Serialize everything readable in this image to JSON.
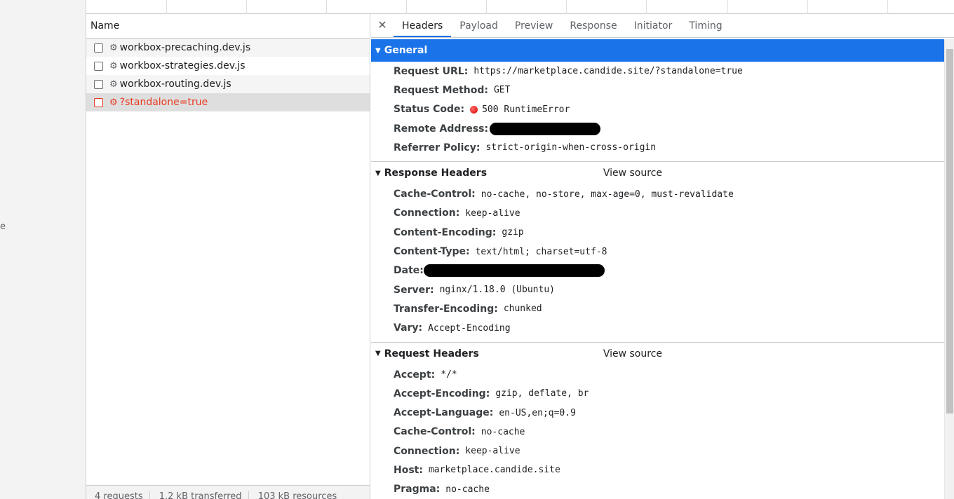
{
  "left_panel": {
    "stub_text": "e"
  },
  "request_list": {
    "column_name": "Name",
    "rows": [
      {
        "name": "workbox-precaching.dev.js"
      },
      {
        "name": "workbox-strategies.dev.js"
      },
      {
        "name": "workbox-routing.dev.js"
      },
      {
        "name": "?standalone=true"
      }
    ],
    "status_bar": {
      "requests": "4 requests",
      "transferred": "1.2 kB transferred",
      "resources": "103 kB resources"
    }
  },
  "tabs": [
    "Headers",
    "Payload",
    "Preview",
    "Response",
    "Initiator",
    "Timing"
  ],
  "general": {
    "title": "General",
    "request_url_key": "Request URL:",
    "request_url": "https://marketplace.candide.site/?standalone=true",
    "request_method_key": "Request Method:",
    "request_method": "GET",
    "status_code_key": "Status Code:",
    "status_code": "500 RuntimeError",
    "remote_address_key": "Remote Address:",
    "referrer_policy_key": "Referrer Policy:",
    "referrer_policy": "strict-origin-when-cross-origin"
  },
  "response_headers": {
    "title": "Response Headers",
    "view_source": "View source",
    "items": [
      {
        "k": "Cache-Control:",
        "v": "no-cache, no-store, max-age=0, must-revalidate"
      },
      {
        "k": "Connection:",
        "v": "keep-alive"
      },
      {
        "k": "Content-Encoding:",
        "v": "gzip"
      },
      {
        "k": "Content-Type:",
        "v": "text/html; charset=utf-8"
      },
      {
        "k": "Date:",
        "v": ""
      },
      {
        "k": "Server:",
        "v": "nginx/1.18.0 (Ubuntu)"
      },
      {
        "k": "Transfer-Encoding:",
        "v": "chunked"
      },
      {
        "k": "Vary:",
        "v": "Accept-Encoding"
      }
    ]
  },
  "request_headers": {
    "title": "Request Headers",
    "view_source": "View source",
    "items": [
      {
        "k": "Accept:",
        "v": "*/*"
      },
      {
        "k": "Accept-Encoding:",
        "v": "gzip, deflate, br"
      },
      {
        "k": "Accept-Language:",
        "v": "en-US,en;q=0.9"
      },
      {
        "k": "Cache-Control:",
        "v": "no-cache"
      },
      {
        "k": "Connection:",
        "v": "keep-alive"
      },
      {
        "k": "Host:",
        "v": "marketplace.candide.site"
      },
      {
        "k": "Pragma:",
        "v": "no-cache"
      }
    ]
  },
  "colors": {
    "accent": "#1a73e8",
    "error": "#e8391f"
  },
  "icons": {
    "close": "close-icon",
    "gear": "gear-icon",
    "triangle": "triangle-down-icon",
    "status": "error-dot-icon"
  }
}
